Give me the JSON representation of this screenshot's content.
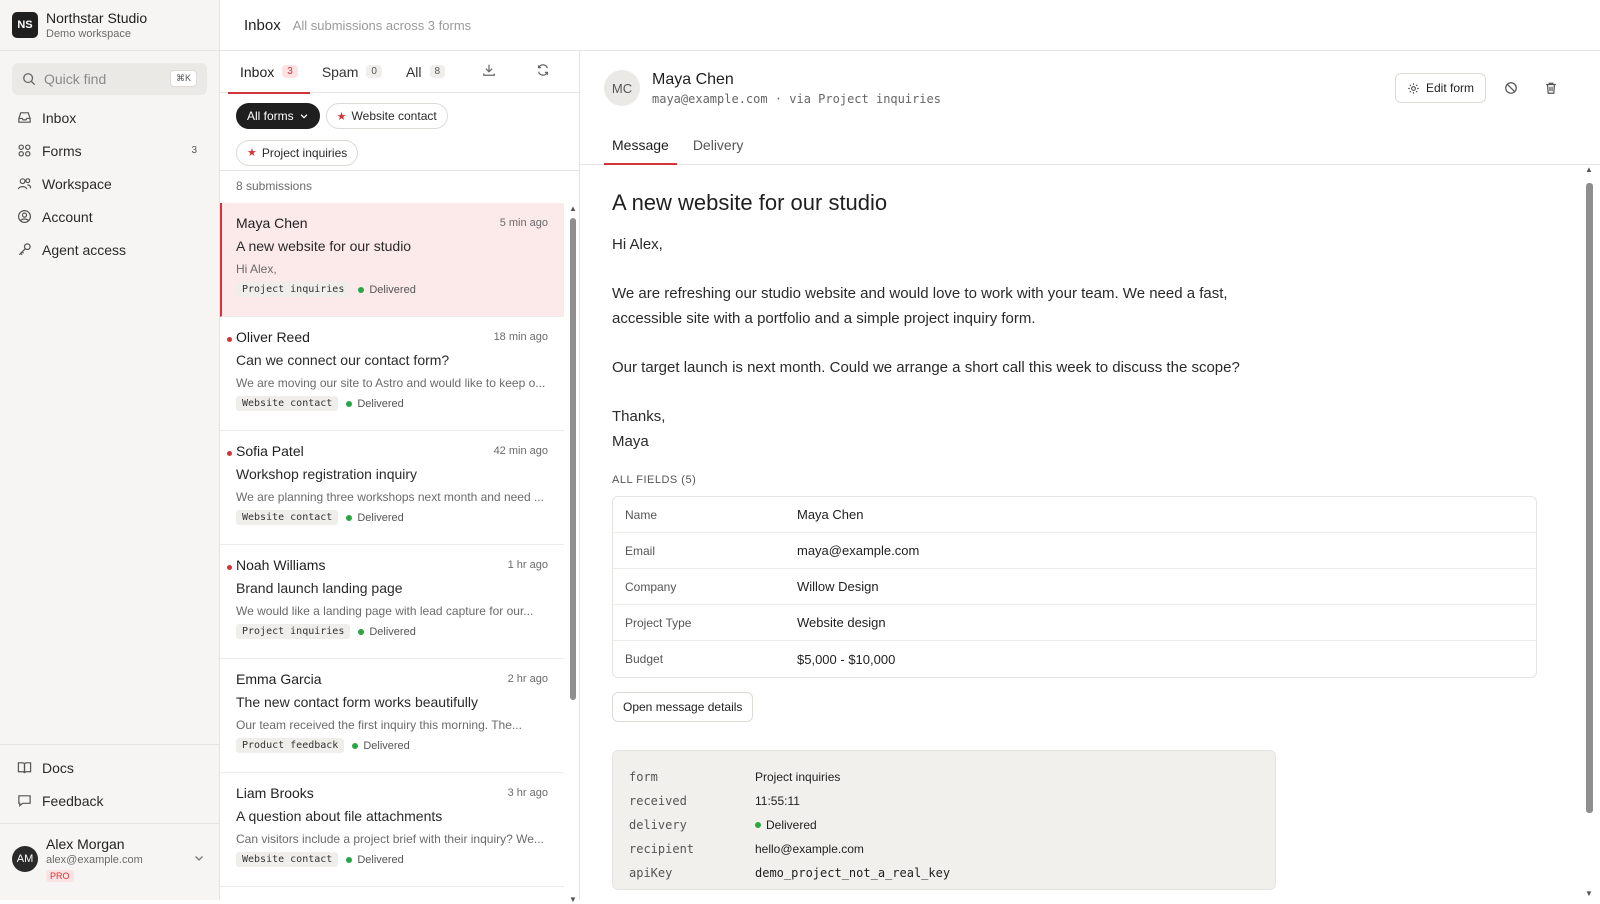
{
  "brand": {
    "logo": "NS",
    "name": "Northstar Studio",
    "workspace": "Demo workspace"
  },
  "search": {
    "placeholder": "Quick find",
    "shortcut": "⌘K"
  },
  "nav": [
    {
      "label": "Inbox",
      "icon": "inbox-icon"
    },
    {
      "label": "Forms",
      "icon": "forms-icon",
      "count": "3"
    },
    {
      "label": "Workspace",
      "icon": "users-icon"
    },
    {
      "label": "Account",
      "icon": "account-icon"
    },
    {
      "label": "Agent access",
      "icon": "key-icon"
    }
  ],
  "nav_bottom": [
    {
      "label": "Docs",
      "icon": "book-icon"
    },
    {
      "label": "Feedback",
      "icon": "chat-icon"
    }
  ],
  "user": {
    "initials": "AM",
    "name": "Alex Morgan",
    "email": "alex@example.com",
    "plan": "PRO"
  },
  "header": {
    "title": "Inbox",
    "subtitle": "All submissions across 3 forms"
  },
  "list": {
    "tabs": [
      {
        "label": "Inbox",
        "count": "3"
      },
      {
        "label": "Spam",
        "count": "0"
      },
      {
        "label": "All",
        "count": "8"
      }
    ],
    "filters": {
      "all": "All forms",
      "website": "Website contact",
      "project": "Project inquiries"
    },
    "count_label": "8 submissions",
    "items": [
      {
        "name": "Maya Chen",
        "time": "5 min ago",
        "subject": "A new website for our studio",
        "preview": "Hi Alex,",
        "form": "Project inquiries",
        "status": "Delivered",
        "unread": false,
        "selected": true
      },
      {
        "name": "Oliver Reed",
        "time": "18 min ago",
        "subject": "Can we connect our contact form?",
        "preview": "We are moving our site to Astro and would like to keep o...",
        "form": "Website contact",
        "status": "Delivered",
        "unread": true
      },
      {
        "name": "Sofia Patel",
        "time": "42 min ago",
        "subject": "Workshop registration inquiry",
        "preview": "We are planning three workshops next month and need ...",
        "form": "Website contact",
        "status": "Delivered",
        "unread": true
      },
      {
        "name": "Noah Williams",
        "time": "1 hr ago",
        "subject": "Brand launch landing page",
        "preview": "We would like a landing page with lead capture for our...",
        "form": "Project inquiries",
        "status": "Delivered",
        "unread": true
      },
      {
        "name": "Emma Garcia",
        "time": "2 hr ago",
        "subject": "The new contact form works beautifully",
        "preview": "Our team received the first inquiry this morning. The...",
        "form": "Product feedback",
        "status": "Delivered",
        "unread": false
      },
      {
        "name": "Liam Brooks",
        "time": "3 hr ago",
        "subject": "A question about file attachments",
        "preview": "Can visitors include a project brief with their inquiry? We...",
        "form": "Website contact",
        "status": "Delivered",
        "unread": false
      }
    ]
  },
  "detail": {
    "initials": "MC",
    "name": "Maya Chen",
    "meta_line": "maya@example.com · via Project inquiries",
    "edit_label": "Edit form",
    "tabs": [
      "Message",
      "Delivery"
    ],
    "subject": "A new website for our studio",
    "body": {
      "greeting": "Hi Alex,",
      "p1": "We are refreshing our studio website and would love to work with your team. We need a fast, accessible site with a portfolio and a simple project inquiry form.",
      "p2": "Our target launch is next month. Could we arrange a short call this week to discuss the scope?",
      "signoff": "Thanks,",
      "signature": "Maya"
    },
    "fields_heading": "ALL FIELDS (5)",
    "fields": [
      {
        "key": "Name",
        "value": "Maya Chen"
      },
      {
        "key": "Email",
        "value": "maya@example.com"
      },
      {
        "key": "Company",
        "value": "Willow Design"
      },
      {
        "key": "Project Type",
        "value": "Website design"
      },
      {
        "key": "Budget",
        "value": "$5,000 - $10,000"
      }
    ],
    "open_details_label": "Open message details",
    "meta": [
      {
        "key": "form",
        "value": "Project inquiries"
      },
      {
        "key": "received",
        "value": "11:55:11"
      },
      {
        "key": "delivery",
        "value": "Delivered"
      },
      {
        "key": "recipient",
        "value": "hello@example.com"
      },
      {
        "key": "apiKey",
        "value": "demo_project_not_a_real_key"
      }
    ]
  },
  "colors": {
    "accent": "#d1343a",
    "success": "#28a745",
    "sidebar_bg": "#f6f5f3"
  }
}
